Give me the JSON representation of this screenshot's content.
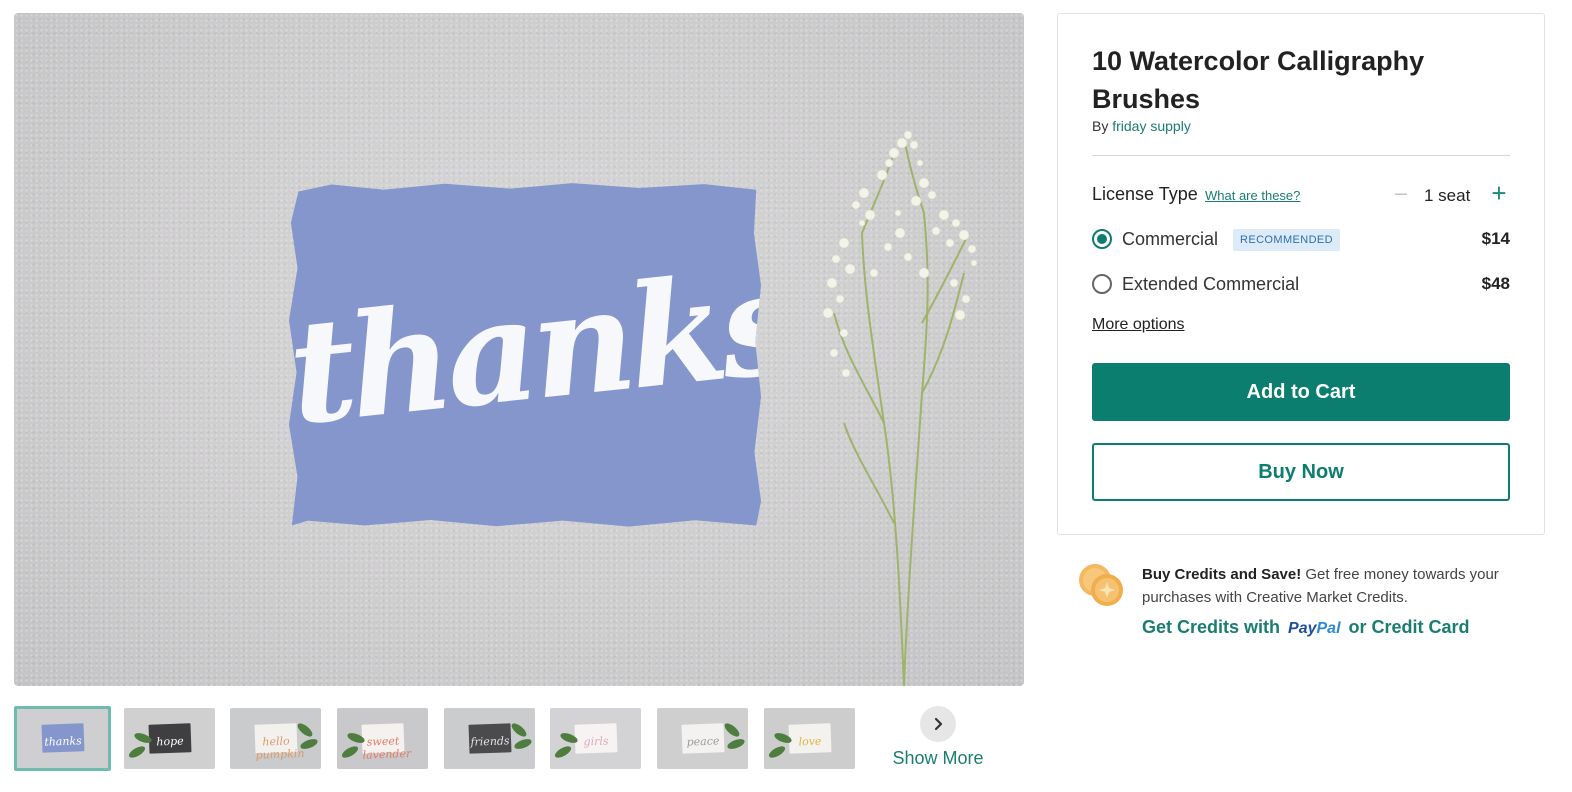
{
  "preview": {
    "image_text": "thanks"
  },
  "thumbnails": [
    {
      "text": "thanks",
      "card": "#8496cb",
      "ink": "#ffffff",
      "bg": "#cfcfd2",
      "selected": true
    },
    {
      "text": "hope",
      "card": "#3f3f42",
      "ink": "#ffffff",
      "bg": "#d0d0d1",
      "selected": false
    },
    {
      "text": "hello pumpkin",
      "card": "#f3f1ee",
      "ink": "#d99a6c",
      "bg": "#cacbcc",
      "selected": false
    },
    {
      "text": "sweet lavender",
      "card": "#f4f1ef",
      "ink": "#e07c66",
      "bg": "#c9c9cb",
      "selected": false
    },
    {
      "text": "friends",
      "card": "#4b4b4d",
      "ink": "#e2e2e2",
      "bg": "#cbcccd",
      "selected": false
    },
    {
      "text": "girls",
      "card": "#f6f3f2",
      "ink": "#e1a7c0",
      "bg": "#d3d3d5",
      "selected": false
    },
    {
      "text": "peace",
      "card": "#f4f2f0",
      "ink": "#9c9c9c",
      "bg": "#cfcfd0",
      "selected": false
    },
    {
      "text": "love",
      "card": "#f4f2ef",
      "ink": "#e2b443",
      "bg": "#cdcdce",
      "selected": false
    }
  ],
  "show_more": {
    "label": "Show More",
    "icon": "chevron-right-icon"
  },
  "product": {
    "title": "10 Watercolor Calligraphy Brushes",
    "by_prefix": "By",
    "author": "friday supply"
  },
  "license": {
    "label": "License Type",
    "help_link": "What are these?",
    "seats": "1 seat",
    "minus_icon": "minus-icon",
    "plus_icon": "plus-icon",
    "options": [
      {
        "name": "Commercial",
        "badge": "RECOMMENDED",
        "price": "$14",
        "selected": true
      },
      {
        "name": "Extended Commercial",
        "badge": "",
        "price": "$48",
        "selected": false
      }
    ],
    "more_options": "More options"
  },
  "actions": {
    "add_to_cart": "Add to Cart",
    "buy_now": "Buy Now"
  },
  "credits": {
    "headline": "Buy Credits and Save!",
    "body": " Get free money towards your purchases with Creative Market Credits.",
    "link_prefix": "Get Credits with",
    "paypal_a": "Pay",
    "paypal_b": "Pal",
    "link_suffix": "or Credit Card",
    "icon": "coins-icon"
  },
  "colors": {
    "accent": "#0b7e6f",
    "link": "#1a7d71",
    "badge_bg": "#dcebf7",
    "badge_text": "#2a6fae"
  }
}
